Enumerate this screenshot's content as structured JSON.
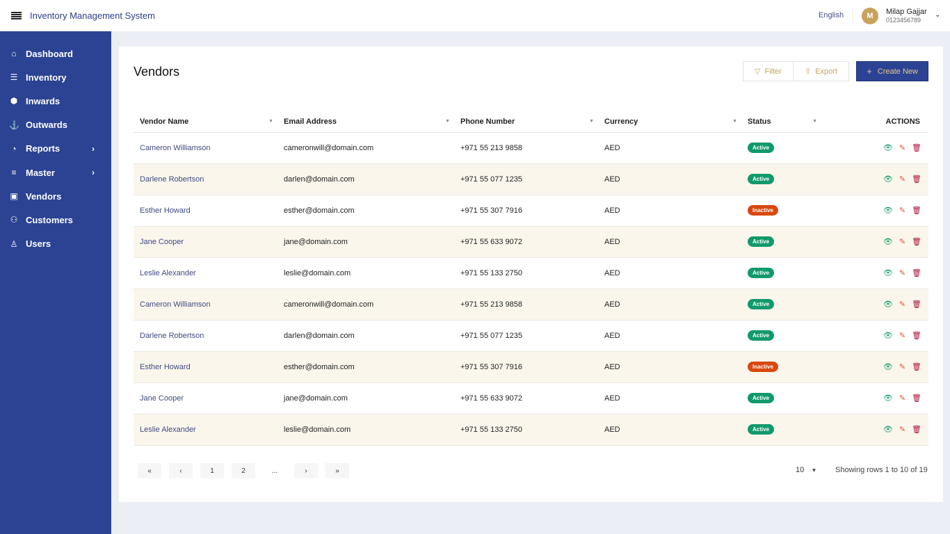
{
  "header": {
    "app_title": "Inventory Management System",
    "language": "English",
    "user": {
      "initial": "M",
      "name": "Milap Gajjar",
      "phone": "0123456789"
    }
  },
  "sidebar": {
    "items": [
      {
        "label": "Dashboard",
        "icon": "home-icon",
        "glyph": "⌂",
        "has_children": false
      },
      {
        "label": "Inventory",
        "icon": "server-icon",
        "glyph": "☰",
        "has_children": false
      },
      {
        "label": "Inwards",
        "icon": "box-icon",
        "glyph": "⬢",
        "has_children": false
      },
      {
        "label": "Outwards",
        "icon": "anchor-icon",
        "glyph": "⚓",
        "has_children": false
      },
      {
        "label": "Reports",
        "icon": "pie-chart-icon",
        "glyph": "◔",
        "has_children": true
      },
      {
        "label": "Master",
        "icon": "list-icon",
        "glyph": "≡",
        "has_children": true
      },
      {
        "label": "Vendors",
        "icon": "shopping-bag-icon",
        "glyph": "▣",
        "has_children": false
      },
      {
        "label": "Customers",
        "icon": "users-icon",
        "glyph": "⚇",
        "has_children": false
      },
      {
        "label": "Users",
        "icon": "user-icon",
        "glyph": "♙",
        "has_children": false
      }
    ]
  },
  "page": {
    "title": "Vendors",
    "filter_label": "Filter",
    "export_label": "Export",
    "create_label": "Create New"
  },
  "table": {
    "columns": [
      "Vendor Name",
      "Email Address",
      "Phone Number",
      "Currency",
      "Status",
      "ACTIONS"
    ],
    "rows": [
      {
        "name": "Cameron Williamson",
        "email": "cameronwill@domain.com",
        "phone": "+971 55 213 9858",
        "currency": "AED",
        "status": "Active"
      },
      {
        "name": "Darlene Robertson",
        "email": "darlen@domain.com",
        "phone": "+971 55 077 1235",
        "currency": "AED",
        "status": "Active"
      },
      {
        "name": "Esther Howard",
        "email": "esther@domain.com",
        "phone": "+971 55 307 7916",
        "currency": "AED",
        "status": "Inactive"
      },
      {
        "name": "Jane Cooper",
        "email": "jane@domain.com",
        "phone": "+971 55 633 9072",
        "currency": "AED",
        "status": "Active"
      },
      {
        "name": "Leslie Alexander",
        "email": "leslie@domain.com",
        "phone": "+971 55 133 2750",
        "currency": "AED",
        "status": "Active"
      },
      {
        "name": "Cameron Williamson",
        "email": "cameronwill@domain.com",
        "phone": "+971 55 213 9858",
        "currency": "AED",
        "status": "Active"
      },
      {
        "name": "Darlene Robertson",
        "email": "darlen@domain.com",
        "phone": "+971 55 077 1235",
        "currency": "AED",
        "status": "Active"
      },
      {
        "name": "Esther Howard",
        "email": "esther@domain.com",
        "phone": "+971 55 307 7916",
        "currency": "AED",
        "status": "Inactive"
      },
      {
        "name": "Jane Cooper",
        "email": "jane@domain.com",
        "phone": "+971 55 633 9072",
        "currency": "AED",
        "status": "Active"
      },
      {
        "name": "Leslie Alexander",
        "email": "leslie@domain.com",
        "phone": "+971 55 133 2750",
        "currency": "AED",
        "status": "Active"
      }
    ]
  },
  "pagination": {
    "buttons": [
      "«",
      "‹",
      "1",
      "2",
      "...",
      "›",
      "»"
    ],
    "per_page": "10",
    "showing": "Showing rows 1 to 10 of 19"
  },
  "colors": {
    "sidebar": "#2b4392",
    "accent_gold": "#c9a15a",
    "active": "#119a6c",
    "inactive": "#d9480f",
    "view": "#119a6c",
    "edit": "#e0523a",
    "delete": "#b0103a"
  }
}
